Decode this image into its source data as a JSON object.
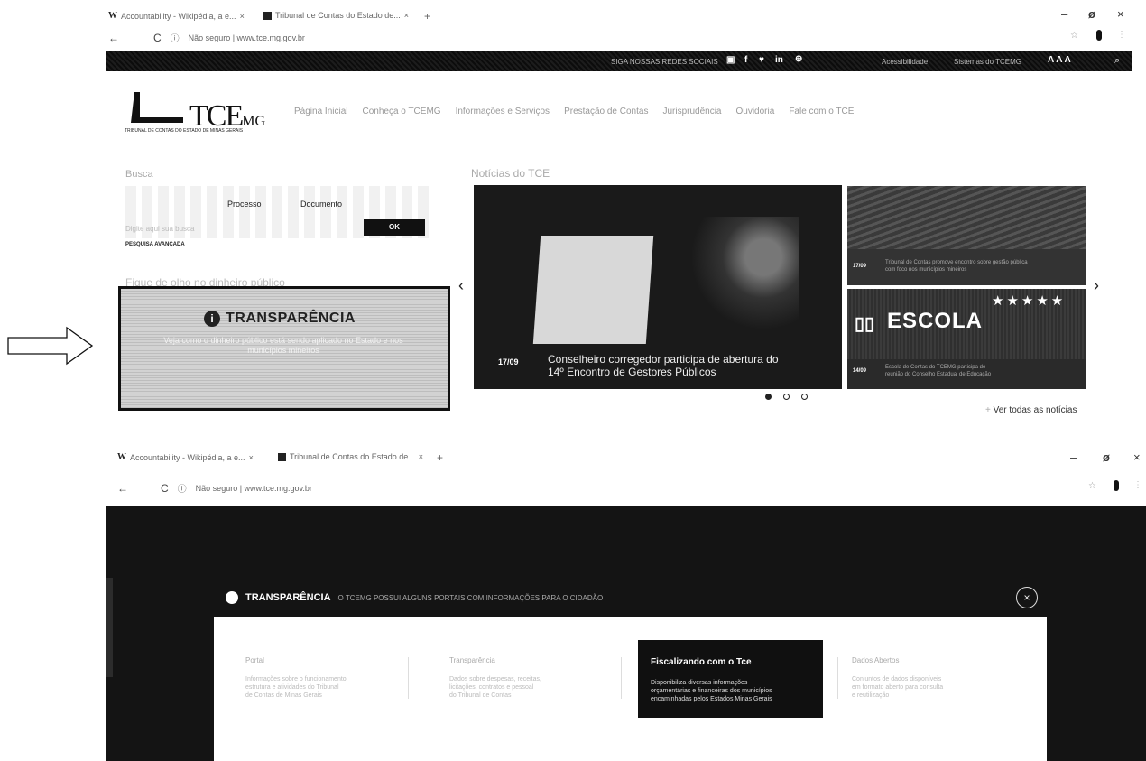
{
  "top_window": {
    "tabs": [
      {
        "title": "Accountability - Wikipédia, a e..."
      },
      {
        "title": "Tribunal de Contas do Estado de..."
      }
    ],
    "address": "Não seguro | www.tce.mg.gov.br",
    "topbar": {
      "center_text": "SIGA NOSSAS REDES SOCIAIS",
      "right_links": [
        "Acessibilidade",
        "Sistemas do TCEMG"
      ],
      "font_size_label": "A A A"
    },
    "logo": {
      "text": "TCE",
      "suffix": "MG",
      "subtitle": "TRIBUNAL DE CONTAS DO ESTADO DE MINAS GERAIS"
    },
    "nav": [
      "Página Inicial",
      "Conheça o TCEMG",
      "Informações e Serviços",
      "Prestação de Contas",
      "Jurisprudência",
      "Ouvidoria",
      "Fale com o TCE"
    ],
    "search": {
      "title": "Busca",
      "segments": [
        "Processo",
        "Documento"
      ],
      "placeholder": "Digite aqui sua busca",
      "ok": "OK",
      "advanced": "PESQUISA AVANÇADA"
    },
    "transparency": {
      "heading": "Fique de olho no dinheiro público",
      "title": "TRANSPARÊNCIA",
      "text": "Veja como o dinheiro público está sendo aplicado no Estado e nos municípios mineiros"
    },
    "news": {
      "heading": "Notícias do TCE",
      "main": {
        "date": "17/09",
        "caption": [
          "Conselheiro corregedor participa de abertura do",
          "14º Encontro de Gestores Públicos"
        ]
      },
      "side": [
        {
          "date": "17/09",
          "caption": [
            "Tribunal de Contas promove encontro sobre gestão pública",
            "com foco nos municípios mineiros"
          ]
        },
        {
          "date": "14/09",
          "banner": "ESCOLA",
          "caption": [
            "Escola de Contas do TCEMG participa de",
            "reunião do Conselho Estadual de Educação"
          ]
        }
      ],
      "see_all": "Ver todas as notícias"
    }
  },
  "bottom_window": {
    "tabs": [
      {
        "title": "Accountability - Wikipédia, a e..."
      },
      {
        "title": "Tribunal de Contas do Estado de..."
      }
    ],
    "address": "Não seguro | www.tce.mg.gov.br",
    "overlay": {
      "title": "TRANSPARÊNCIA",
      "subtitle": "O TCEMG POSSUI ALGUNS PORTAIS COM INFORMAÇÕES PARA O CIDADÃO",
      "close": "×",
      "cards": [
        {
          "title": "Portal",
          "text": [
            "Informações sobre o funcionamento,",
            "estrutura e atividades do Tribunal",
            "de Contas de Minas Gerais"
          ]
        },
        {
          "title": "Transparência",
          "text": [
            "Dados sobre despesas, receitas,",
            "licitações, contratos e pessoal",
            "do Tribunal de Contas"
          ]
        },
        {
          "title": "Fiscalizando com o Tce",
          "text": [
            "Disponibiliza diversas informações",
            "orçamentárias e financeiras dos municípios",
            "encaminhadas pelos Estados Minas Gerais"
          ]
        },
        {
          "title": "Dados Abertos",
          "text": [
            "Conjuntos de dados disponíveis",
            "em formato aberto para consulta",
            "e reutilização"
          ]
        }
      ]
    }
  },
  "colors": {
    "dark": "#141414",
    "accent": "#111111",
    "gray_box": "#c8c8c8"
  },
  "icons": [
    "arrow-right-outline-icon",
    "info-icon",
    "youtube-icon",
    "facebook-icon",
    "twitter-icon",
    "linkedin-icon",
    "flickr-icon",
    "search-icon",
    "close-icon",
    "chevron-left-icon",
    "chevron-right-icon",
    "star-icon"
  ]
}
